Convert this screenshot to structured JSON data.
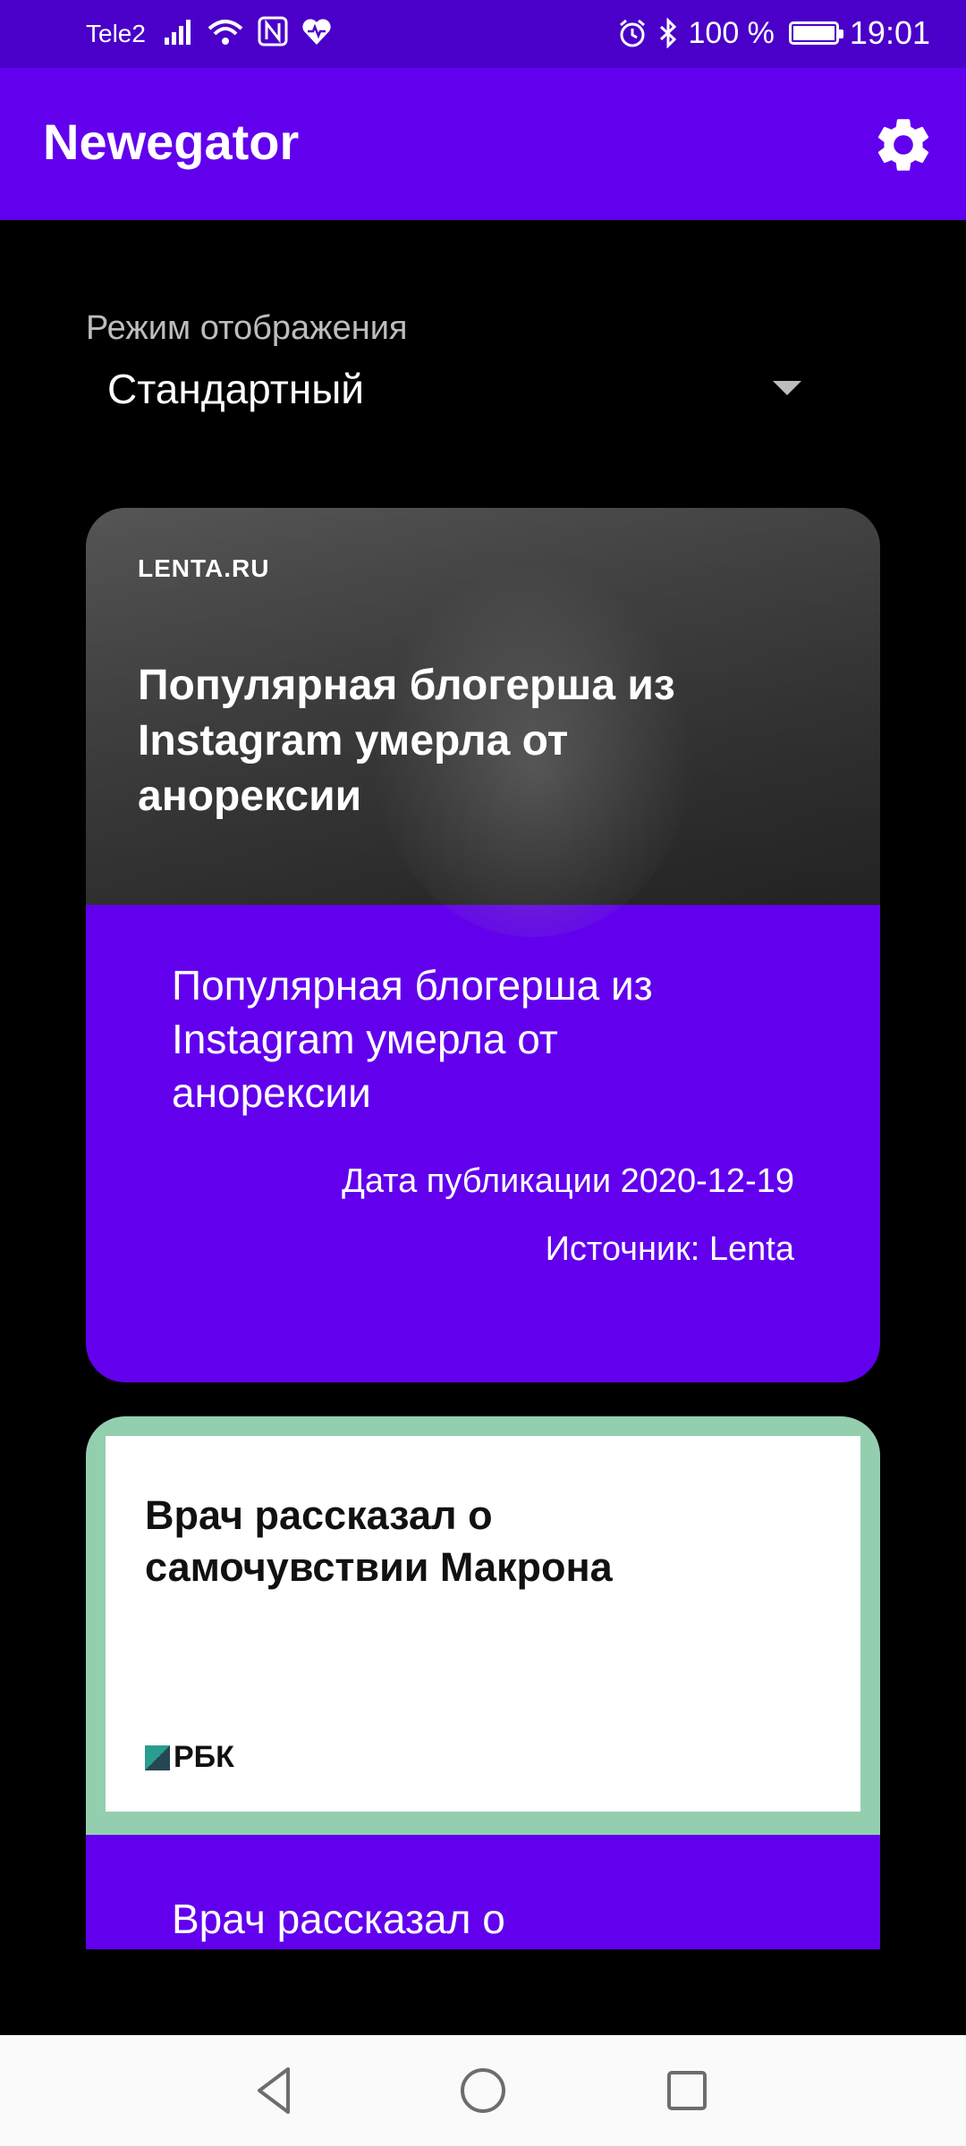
{
  "status_bar": {
    "carrier": "Tele2",
    "battery": "100 %",
    "time": "19:01"
  },
  "app_bar": {
    "title": "Newegator"
  },
  "display_mode": {
    "label": "Режим отображения",
    "value": "Стандартный"
  },
  "articles": [
    {
      "image_logo": "LENTA.RU",
      "image_headline": "Популярная блогерша из Instagram умерла от анорексии",
      "title": "Популярная блогерша из Instagram умерла от анорексии",
      "pub_date": "Дата публикации 2020-12-19",
      "source": "Источник: Lenta"
    },
    {
      "image_logo": "РБК",
      "image_headline": "Врач рассказал о самочувствии Макрона",
      "title": "Врач рассказал о самочувствии Макрона"
    }
  ],
  "colors": {
    "primary": "#6200ee",
    "status_bar": "#4a00c8",
    "background": "#000000",
    "rbk_frame": "#93cfae"
  },
  "icons": [
    "signal-icon",
    "wifi-icon",
    "nfc-icon",
    "health-icon",
    "alarm-icon",
    "bluetooth-icon",
    "battery-icon",
    "gear-icon",
    "back-icon",
    "home-icon",
    "recents-icon"
  ]
}
